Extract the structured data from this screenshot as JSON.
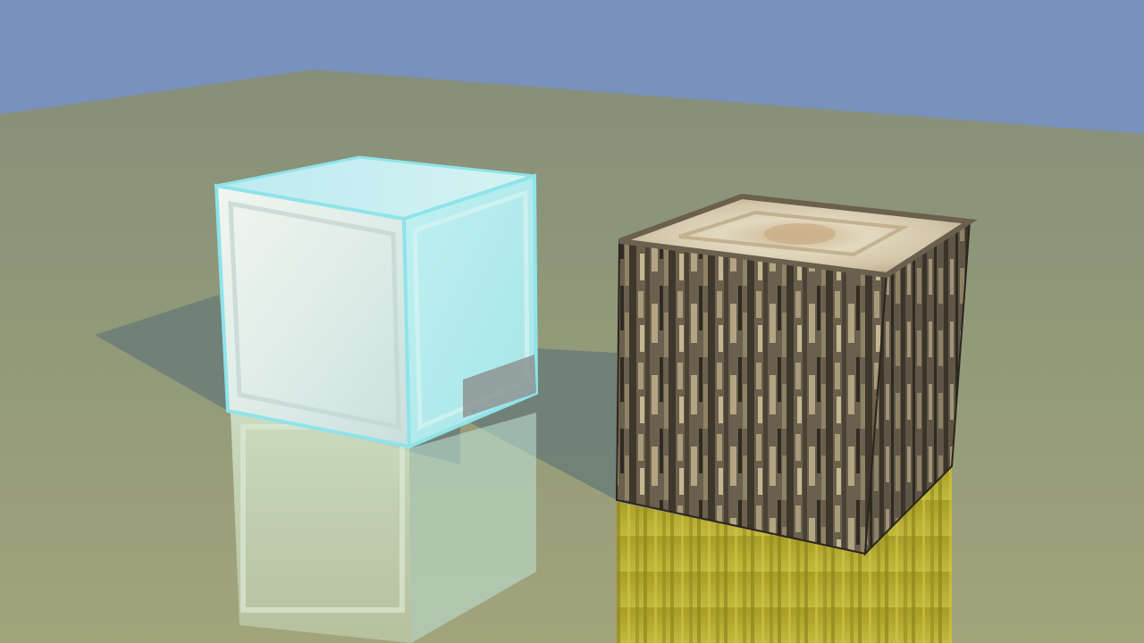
{
  "scene": {
    "sky_color": "#7891bd",
    "floor_color": "#8f9878",
    "floor_far_color": "#8a9277",
    "floor_near_color": "#9ea07a",
    "shadow_color": "#6f7e78",
    "objects": [
      {
        "kind": "glass-block",
        "material": "glass",
        "colors": {
          "top": "#c9eef2",
          "front": "#e6f4f0",
          "side": "#b9ecef",
          "edge": "#8fe3ea"
        }
      },
      {
        "kind": "wood-log-block",
        "material": "oak-log",
        "colors": {
          "top": "#d8ceb4",
          "bark_dark": "#3d372c",
          "bark_mid": "#6b604d",
          "bark_light": "#a99a7b",
          "reflection": "#b8b030"
        }
      }
    ]
  }
}
